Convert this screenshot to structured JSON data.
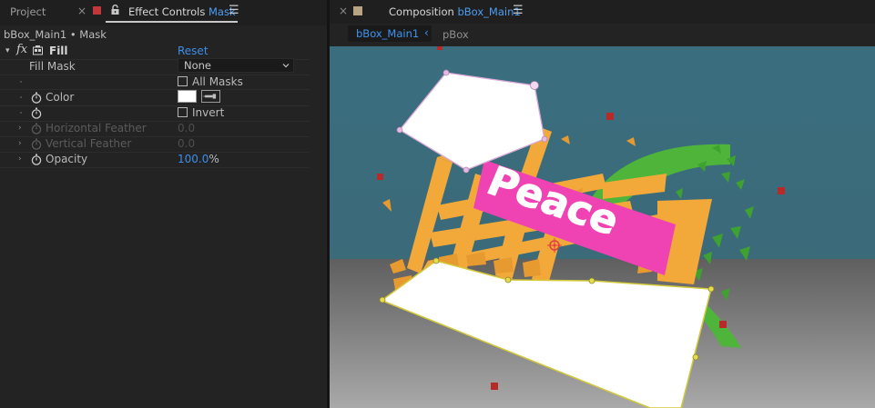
{
  "left_panel": {
    "tabs": {
      "project": "Project",
      "close_glyph": "×",
      "effect_controls_prefix": "Effect Controls",
      "effect_controls_target": "Mask",
      "menu_glyph": "☰",
      "swatch_color": "#c2383a"
    },
    "path": "bBox_Main1 • Mask",
    "effect": {
      "name": "Fill",
      "reset_label": "Reset",
      "params": {
        "fill_mask": {
          "label": "Fill Mask",
          "value": "None"
        },
        "all_masks": {
          "label": "All Masks",
          "checked": false
        },
        "color": {
          "label": "Color",
          "value": "#ffffff"
        },
        "invert": {
          "label": "Invert",
          "checked": false
        },
        "horizontal_feather": {
          "label": "Horizontal Feather",
          "value": "0.0"
        },
        "vertical_feather": {
          "label": "Vertical Feather",
          "value": "0.0"
        },
        "opacity": {
          "label": "Opacity",
          "value": "100.0",
          "unit": "%"
        }
      }
    }
  },
  "right_panel": {
    "tab": {
      "close_glyph": "×",
      "prefix": "Composition",
      "name": "bBox_Main1",
      "menu_glyph": "☰",
      "swatch_color": "#b8a485"
    },
    "breadcrumbs": {
      "active": "bBox_Main1",
      "chevron": "‹",
      "next": "pBox"
    },
    "viewer": {
      "logo_text": "Peace"
    }
  }
}
